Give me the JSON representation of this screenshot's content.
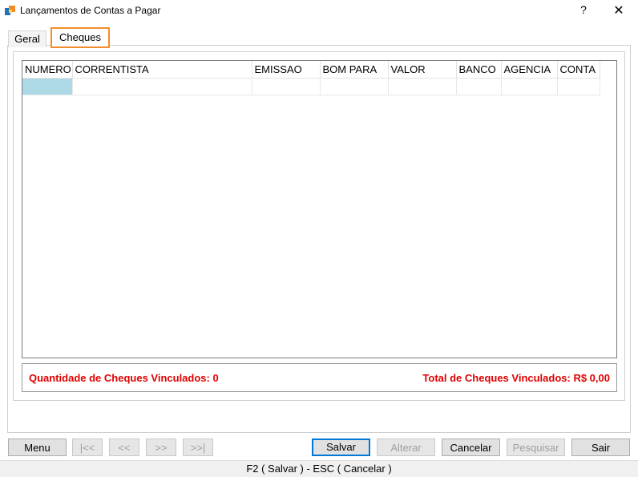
{
  "window": {
    "title": "Lançamentos de Contas a Pagar",
    "help": "?",
    "close": "✕"
  },
  "tabs": [
    {
      "label": "Geral"
    },
    {
      "label": "Cheques"
    }
  ],
  "grid": {
    "columns": [
      "NUMERO",
      "CORRENTISTA",
      "EMISSAO",
      "BOM PARA",
      "VALOR",
      "BANCO",
      "AGENCIA",
      "CONTA"
    ]
  },
  "summary": {
    "quantidade": "Quantidade de Cheques Vinculados: 0",
    "total": "Total de Cheques Vinculados: R$ 0,00"
  },
  "buttons": {
    "menu": "Menu",
    "first": "|<<",
    "prev": "<<",
    "next": ">>",
    "last": ">>|",
    "salvar": "Salvar",
    "alterar": "Alterar",
    "cancelar": "Cancelar",
    "pesquisar": "Pesquisar",
    "sair": "Sair"
  },
  "statusbar": {
    "text": "F2 ( Salvar )  -  ESC ( Cancelar )"
  },
  "colors": {
    "accent_tab": "#f28c28",
    "summary_text": "#e00000",
    "selected_cell": "#add8e6",
    "default_button": "#0078d7"
  }
}
